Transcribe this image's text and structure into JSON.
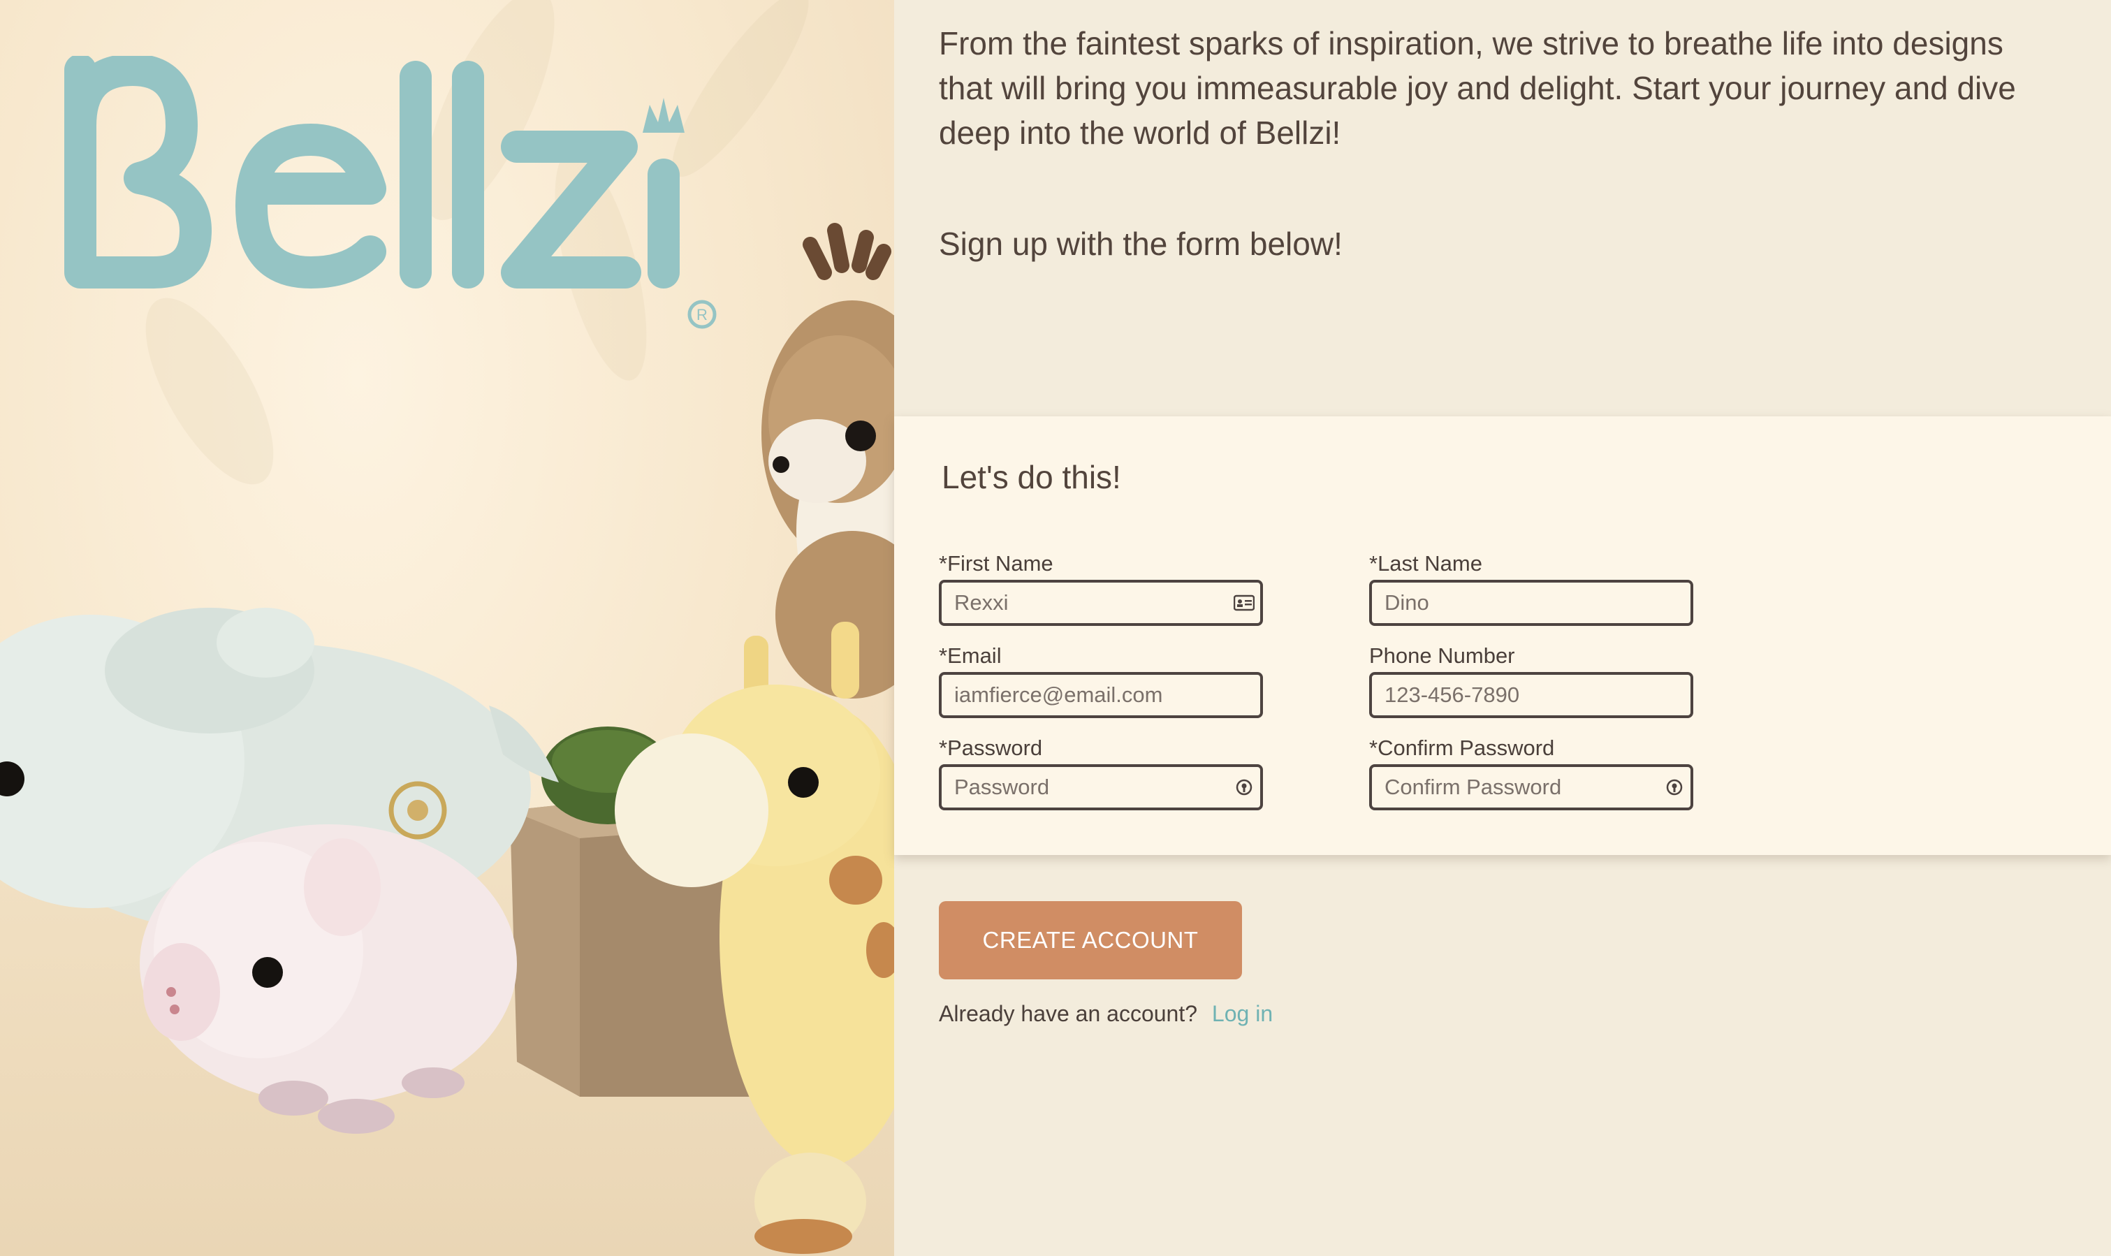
{
  "brand": {
    "logo_text": "Bellzi",
    "accent_color": "#95c4c4"
  },
  "intro": {
    "paragraph": "From the faintest sparks of inspiration, we strive to breathe life into designs that will bring you immeasurable joy and delight. Start your journey and dive deep into the world of Bellzi!",
    "signup_prompt": "Sign up with the form below!"
  },
  "form": {
    "title": "Let's do this!",
    "fields": {
      "first_name": {
        "label": "*First Name",
        "placeholder": "Rexxi",
        "icon": "contact-card-icon"
      },
      "last_name": {
        "label": "*Last Name",
        "placeholder": "Dino"
      },
      "email": {
        "label": "*Email",
        "placeholder": "iamfierce@email.com"
      },
      "phone": {
        "label": "Phone Number",
        "placeholder": "123-456-7890"
      },
      "password": {
        "label": "*Password",
        "placeholder": "Password",
        "icon": "password-key-icon"
      },
      "confirm_password": {
        "label": "*Confirm Password",
        "placeholder": "Confirm Password",
        "icon": "password-key-icon"
      }
    },
    "submit_label": "CREATE ACCOUNT",
    "submit_color": "#d08d64"
  },
  "login": {
    "prompt": "Already have an account?",
    "link_label": "Log in",
    "link_color": "#6fb2b3"
  }
}
